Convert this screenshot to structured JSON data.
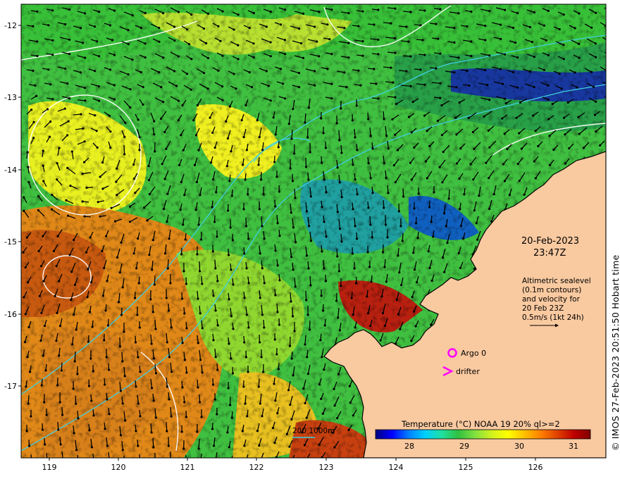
{
  "map": {
    "lat_ticks": [
      "-12",
      "-13",
      "-14",
      "-15",
      "-16",
      "-17"
    ],
    "lon_ticks": [
      "119",
      "120",
      "121",
      "122",
      "123",
      "124",
      "125",
      "126"
    ],
    "timestamp": {
      "date": "20-Feb-2023",
      "time": "23:47Z"
    },
    "altimetry_note": [
      "Altimetric sealevel",
      "(0.1m contours)",
      "and velocity for",
      "20 Feb 23Z",
      "0.5m/s (1kt 24h)"
    ],
    "markers": [
      {
        "label": "Argo 0",
        "color": "#ff00ff",
        "icon": "circle"
      },
      {
        "label": "drifter",
        "color": "#ff00ff",
        "icon": "chevron-right"
      }
    ],
    "bathymetry_label": "200  1000m",
    "colorbar": {
      "title": "Temperature (°C) NOAA 19 20% ql>=2",
      "ticks": [
        "28",
        "29",
        "30",
        "31"
      ],
      "min": 27.3,
      "max": 31.3,
      "colors": [
        "#00007f",
        "#0000ff",
        "#0080ff",
        "#00d0ff",
        "#20e0a0",
        "#30c040",
        "#80e040",
        "#d0f020",
        "#ffff00",
        "#ffc000",
        "#ff8000",
        "#e04000",
        "#c00000",
        "#800000"
      ]
    },
    "copyright": "© IMOS 27-Feb-2023 20:51:50 Hobart time",
    "land_color": "#f9c9a0",
    "contour_color_altimetry": "#ffffff",
    "contour_color_bathymetry": "#40d0e0",
    "arrow_color": "#000000"
  }
}
